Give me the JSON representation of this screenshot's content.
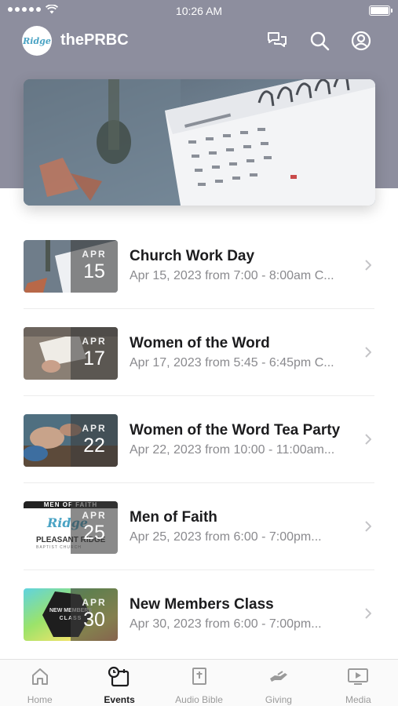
{
  "status_bar": {
    "time": "10:26 AM"
  },
  "app": {
    "title": "thePRBC",
    "logo_text": "Ridge"
  },
  "events": [
    {
      "month": "APR",
      "day": "15",
      "title": "Church Work Day",
      "subtitle": "Apr 15, 2023 from 7:00 - 8:00am C..."
    },
    {
      "month": "APR",
      "day": "17",
      "title": "Women of the Word",
      "subtitle": "Apr 17, 2023 from 5:45 - 6:45pm C..."
    },
    {
      "month": "APR",
      "day": "22",
      "title": "Women of the Word Tea Party",
      "subtitle": "Apr 22, 2023 from 10:00 - 11:00am..."
    },
    {
      "month": "APR",
      "day": "25",
      "title": "Men of Faith",
      "subtitle": "Apr 25, 2023 from 6:00 - 7:00pm..."
    },
    {
      "month": "APR",
      "day": "30",
      "title": "New Members Class",
      "subtitle": "Apr 30, 2023 from 6:00 - 7:00pm..."
    }
  ],
  "thumb_text": {
    "men_banner": "MEN OF FAITH",
    "men_logo": "Ridge",
    "men_church": "PLEASANT RIDGE",
    "men_church_sub": "BAPTIST CHURCH",
    "members_line1": "NEW MEMBERS",
    "members_line2": "CLASS"
  },
  "tabs": [
    {
      "label": "Home",
      "icon": "home-icon"
    },
    {
      "label": "Events",
      "icon": "calendar-clock-icon"
    },
    {
      "label": "Audio Bible",
      "icon": "bible-icon"
    },
    {
      "label": "Giving",
      "icon": "giving-hand-icon"
    },
    {
      "label": "Media",
      "icon": "media-play-icon"
    }
  ],
  "colors": {
    "header_bg": "#8d8e9e",
    "active_tab": "#1c1c1e",
    "inactive_tab": "#9a9a9a"
  }
}
